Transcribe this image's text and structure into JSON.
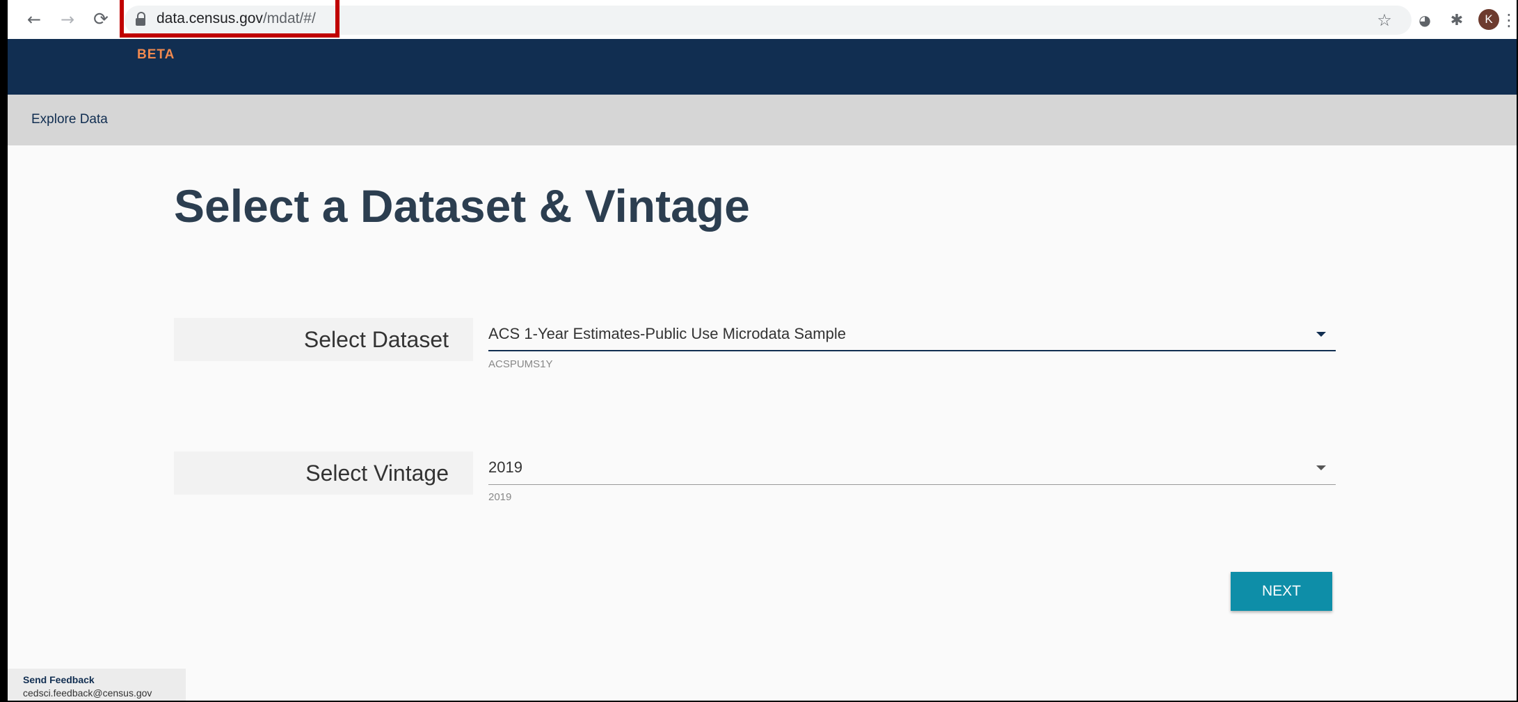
{
  "browser": {
    "url_host": "data.census.gov",
    "url_path": "/mdat/#/",
    "avatar_letter": "K"
  },
  "header": {
    "badge": "BETA"
  },
  "subnav": {
    "item": "Explore Data"
  },
  "main": {
    "title": "Select a Dataset & Vintage",
    "dataset": {
      "label": "Select Dataset",
      "value": "ACS 1-Year Estimates-Public Use Microdata Sample",
      "hint": "ACSPUMS1Y"
    },
    "vintage": {
      "label": "Select Vintage",
      "value": "2019",
      "hint": "2019"
    },
    "next_label": "NEXT"
  },
  "footer": {
    "feedback_title": "Send Feedback",
    "feedback_email": "cedsci.feedback@census.gov"
  },
  "colors": {
    "header_bg": "#112e51",
    "beta": "#f0894f",
    "next_button": "#0e8ea8",
    "highlight": "#c00000"
  }
}
